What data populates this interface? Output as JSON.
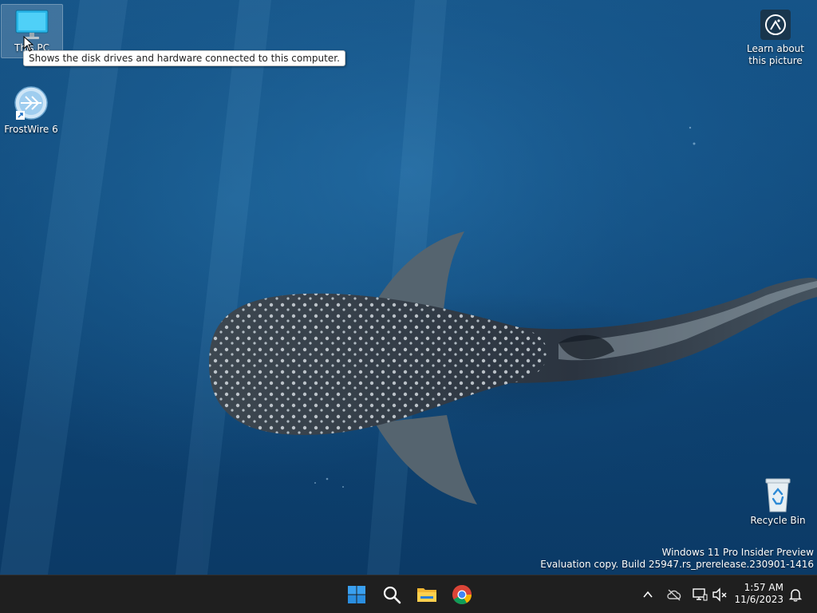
{
  "desktop": {
    "icons": [
      {
        "label": "This PC",
        "icon": "monitor-icon"
      },
      {
        "label": "FrostWire 6",
        "icon": "frostwire-icon"
      },
      {
        "label": "Recycle Bin",
        "icon": "recycle-bin-icon"
      }
    ],
    "tooltip": "Shows the disk drives and hardware connected to this computer.",
    "learn_picture": {
      "line1": "Learn about",
      "line2": "this picture",
      "icon": "camera-aperture-icon"
    },
    "watermark": {
      "line1": "Windows 11 Pro Insider Preview",
      "line2": "Evaluation copy. Build 25947.rs_prerelease.230901-1416"
    }
  },
  "taskbar": {
    "apps": [
      {
        "name": "Start",
        "icon": "windows-start-icon"
      },
      {
        "name": "Search",
        "icon": "search-icon"
      },
      {
        "name": "File Explorer",
        "icon": "folder-icon"
      },
      {
        "name": "Google Chrome",
        "icon": "chrome-icon"
      }
    ],
    "tray": [
      {
        "icon": "chevron-up-icon"
      },
      {
        "icon": "cloud-offline-icon"
      },
      {
        "icon": "network-icon"
      },
      {
        "icon": "volume-muted-icon"
      },
      {
        "icon": "notification-bell-icon"
      }
    ],
    "clock": {
      "time": "1:57 AM",
      "date": "11/6/2023"
    }
  },
  "colors": {
    "taskbar_bg": "#1f1f1f",
    "accent_blue": "#0078d4",
    "desktop_blue": "#0f4677"
  }
}
